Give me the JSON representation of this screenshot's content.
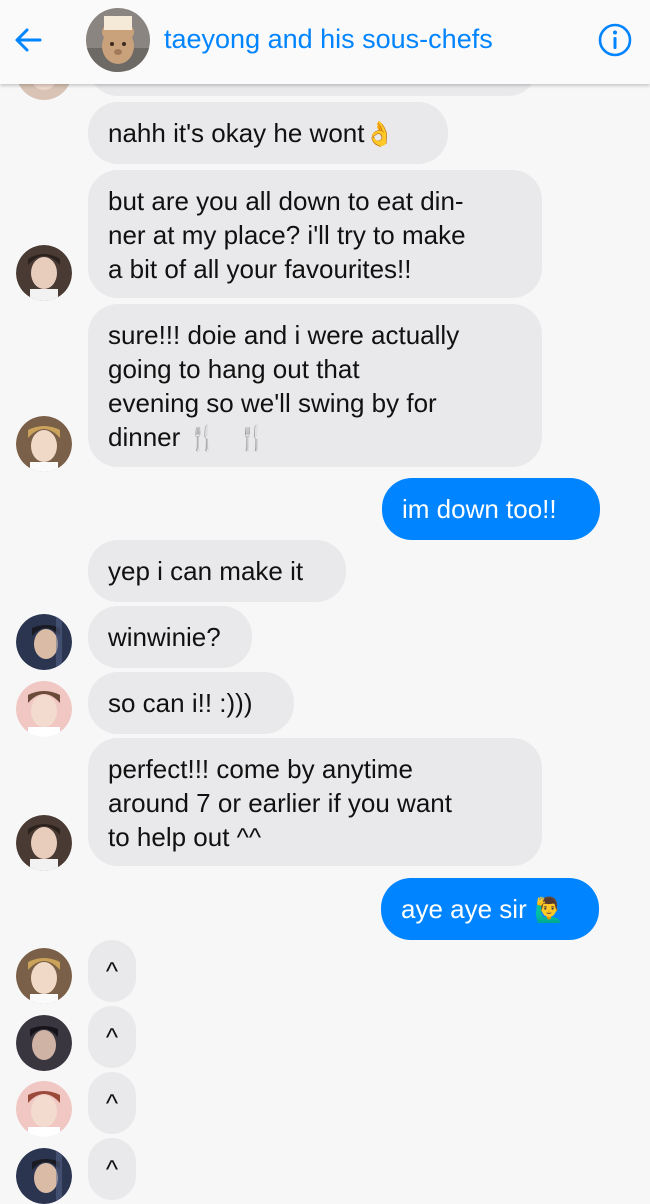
{
  "header": {
    "title": "taeyong and his sous-chefs",
    "back_icon": "arrow-left-icon",
    "info_icon": "info-icon",
    "accent_color": "#0084ff"
  },
  "messages": [
    {
      "sender": "other",
      "text": "nahh it's okay he wont",
      "emoji": "👌"
    },
    {
      "sender": "other",
      "lines": [
        "but are you all down to eat din-",
        "ner at my place? i'll try to make",
        "a bit of all your favourites!!"
      ]
    },
    {
      "sender": "other",
      "lines": [
        "sure!!! doie and i were actually",
        "going to hang out that",
        "evening so we'll swing by for",
        "dinner"
      ],
      "emoji": "🍴 🍴"
    },
    {
      "sender": "me",
      "text": "im down too!!"
    },
    {
      "sender": "other",
      "text": "yep i can make it"
    },
    {
      "sender": "other",
      "text": "winwinie?"
    },
    {
      "sender": "other",
      "text": "so can i!! :)))"
    },
    {
      "sender": "other",
      "lines": [
        "perfect!!! come by anytime",
        "around 7 or earlier if you want",
        "to help out ^^"
      ]
    },
    {
      "sender": "me",
      "text": "aye aye sir",
      "emoji": "🙋‍♂️"
    },
    {
      "sender": "other",
      "text": "^"
    },
    {
      "sender": "other",
      "text": "^"
    },
    {
      "sender": "other",
      "text": "^"
    },
    {
      "sender": "other",
      "text": "^"
    }
  ],
  "colors": {
    "my_bubble": "#0084ff",
    "other_bubble": "#e9e9eb",
    "background": "#f7f7f7"
  }
}
